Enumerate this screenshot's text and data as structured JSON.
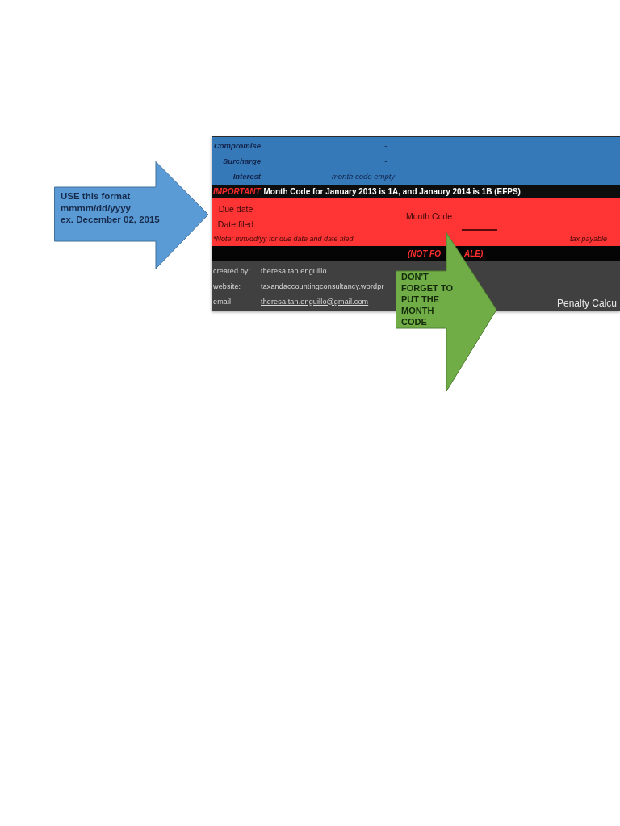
{
  "sheet": {
    "summary_rows": [
      {
        "label": "Compromise",
        "value": "-",
        "kind": "amount"
      },
      {
        "label": "Surcharge",
        "value": "-",
        "kind": "amount"
      },
      {
        "label": "Interest",
        "value": "month code empty",
        "kind": "status"
      }
    ],
    "notice": {
      "tag": "IMPORTANT",
      "text": "Month Code for January 2013 is 1A, and Janaury 2014 is 1B (EFPS)"
    },
    "dates": {
      "fields": [
        "Due date",
        "Date filed"
      ],
      "month_code_label": "Month Code",
      "note": "*Note: mm/dd/yy for due date and date filed",
      "tax_label": "tax payable"
    },
    "banner": [
      "(NOT FO",
      "ALE)"
    ],
    "credits": [
      {
        "label": "created by:",
        "value": "theresa tan enguillo",
        "kind": "text"
      },
      {
        "label": "website:",
        "value": "taxandaccountingconsultancy.wordpr",
        "kind": "text"
      },
      {
        "label": "email:",
        "value": "theresa.tan.enguillo@gmail.com",
        "kind": "link"
      }
    ],
    "title": "Penalty Calcu"
  },
  "callouts": [
    {
      "color": "#5b9bd5",
      "lines": [
        "USE this format",
        "mmmm/dd/yyyy",
        "ex. December 02, 2015"
      ]
    },
    {
      "color": "#70ad47",
      "lines": [
        "DON'T",
        "FORGET TO",
        "PUT THE",
        "MONTH",
        "CODE"
      ]
    }
  ]
}
